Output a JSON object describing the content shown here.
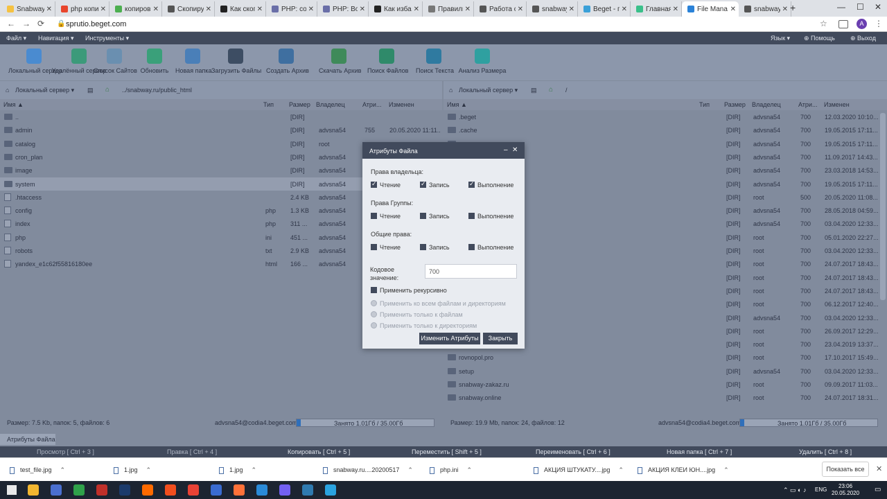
{
  "browser": {
    "tabs": [
      {
        "title": "Snabway",
        "color": "#f5c242"
      },
      {
        "title": "php копи",
        "color": "#e8452c"
      },
      {
        "title": "копиров",
        "color": "#4caf50"
      },
      {
        "title": "Скопиру",
        "color": "#555555"
      },
      {
        "title": "Как скоп",
        "color": "#222222"
      },
      {
        "title": "PHP: cop",
        "color": "#6a6fa8"
      },
      {
        "title": "PHP: Воз",
        "color": "#6a6fa8"
      },
      {
        "title": "Как изба",
        "color": "#222222"
      },
      {
        "title": "Правиль",
        "color": "#777777"
      },
      {
        "title": "Работа с",
        "color": "#555555"
      },
      {
        "title": "snabway",
        "color": "#555555"
      },
      {
        "title": "Beget - п",
        "color": "#3aa0d8"
      },
      {
        "title": "Главная",
        "color": "#3ac08a"
      },
      {
        "title": "File Mana",
        "color": "#2a82d8"
      },
      {
        "title": "snabway",
        "color": "#555555"
      }
    ],
    "url": "sprutio.beget.com",
    "avatar": "A"
  },
  "menubar": {
    "items": [
      "Файл ▾",
      "Навигация ▾",
      "Инструменты ▾"
    ],
    "right": [
      "Язык ▾",
      "Помощь",
      "Выход"
    ]
  },
  "toolbar": {
    "buttons": [
      {
        "label": "Локальный сервер",
        "color": "#4a8bd0"
      },
      {
        "label": "Удалённый сервер",
        "color": "#3c9a7a"
      },
      {
        "label": "Список Сайтов",
        "color": "#6a8fb0"
      },
      {
        "label": "Обновить",
        "color": "#3aa07a"
      },
      {
        "label": "Новая папка",
        "color": "#4a7fb8"
      },
      {
        "label": "Загрузить Файлы",
        "color": "#3d4d63"
      },
      {
        "label": "Создать Архив",
        "color": "#3f6fa0"
      },
      {
        "label": "Скачать Архив",
        "color": "#3f8a5a"
      },
      {
        "label": "Поиск Файлов",
        "color": "#2f8a6a"
      },
      {
        "label": "Поиск Текста",
        "color": "#2f7aa0"
      },
      {
        "label": "Анализ Размера",
        "color": "#2fa0a0"
      }
    ]
  },
  "left_panel": {
    "server": "Локальный сервер",
    "path": "../snabway.ru/public_html",
    "columns": [
      "Имя ▲",
      "Тип",
      "Размер",
      "Владелец",
      "Атри...",
      "Изменен"
    ],
    "rows": [
      {
        "name": "..",
        "type": "",
        "size": "[DIR]",
        "owner": "",
        "attr": "",
        "mod": "",
        "dir": true
      },
      {
        "name": "admin",
        "type": "",
        "size": "[DIR]",
        "owner": "advsna54",
        "attr": "755",
        "mod": "20.05.2020 11:11...",
        "dir": true
      },
      {
        "name": "catalog",
        "type": "",
        "size": "[DIR]",
        "owner": "root",
        "attr": "",
        "mod": "",
        "dir": true
      },
      {
        "name": "cron_plan",
        "type": "",
        "size": "[DIR]",
        "owner": "advsna54",
        "attr": "",
        "mod": "",
        "dir": true
      },
      {
        "name": "image",
        "type": "",
        "size": "[DIR]",
        "owner": "advsna54",
        "attr": "",
        "mod": "",
        "dir": true
      },
      {
        "name": "system",
        "type": "",
        "size": "[DIR]",
        "owner": "advsna54",
        "attr": "",
        "mod": "",
        "dir": true,
        "selected": true
      },
      {
        "name": ".htaccess",
        "type": "",
        "size": "2.4 KB",
        "owner": "advsna54",
        "attr": "",
        "mod": "",
        "dir": false
      },
      {
        "name": "config",
        "type": "php",
        "size": "1.3 KB",
        "owner": "advsna54",
        "attr": "",
        "mod": "",
        "dir": false
      },
      {
        "name": "index",
        "type": "php",
        "size": "311 ...",
        "owner": "advsna54",
        "attr": "",
        "mod": "",
        "dir": false
      },
      {
        "name": "php",
        "type": "ini",
        "size": "451 ...",
        "owner": "advsna54",
        "attr": "",
        "mod": "",
        "dir": false
      },
      {
        "name": "robots",
        "type": "txt",
        "size": "2.9 KB",
        "owner": "advsna54",
        "attr": "",
        "mod": "",
        "dir": false
      },
      {
        "name": "yandex_e1c62f55816180ee",
        "type": "html",
        "size": "166 ...",
        "owner": "advsna54",
        "attr": "",
        "mod": "",
        "dir": false
      }
    ],
    "status": "Размер: 7.5 Kb, папок: 5, файлов: 6",
    "user": "advsna54@codia4.beget.com",
    "usage": "Занято 1.01Гб / 35.00Гб",
    "usage_fraction": 0.03
  },
  "right_panel": {
    "server": "Локальный сервер",
    "path": "/",
    "columns": [
      "Имя ▲",
      "Тип",
      "Размер",
      "Владелец",
      "Атри...",
      "Изменен"
    ],
    "rows": [
      {
        "name": ".beget",
        "size": "[DIR]",
        "owner": "advsna54",
        "attr": "700",
        "mod": "12.03.2020 10:10..."
      },
      {
        "name": ".cache",
        "size": "[DIR]",
        "owner": "advsna54",
        "attr": "700",
        "mod": "19.05.2015 17:11..."
      },
      {
        "name": "",
        "size": "[DIR]",
        "owner": "advsna54",
        "attr": "700",
        "mod": "19.05.2015 17:11..."
      },
      {
        "name": "",
        "size": "[DIR]",
        "owner": "advsna54",
        "attr": "700",
        "mod": "11.09.2017 14:43..."
      },
      {
        "name": "",
        "size": "[DIR]",
        "owner": "advsna54",
        "attr": "700",
        "mod": "23.03.2018 14:53..."
      },
      {
        "name": "",
        "size": "[DIR]",
        "owner": "advsna54",
        "attr": "700",
        "mod": "19.05.2015 17:11..."
      },
      {
        "name": "",
        "size": "[DIR]",
        "owner": "root",
        "attr": "500",
        "mod": "20.05.2020 11:08..."
      },
      {
        "name": "",
        "size": "[DIR]",
        "owner": "advsna54",
        "attr": "700",
        "mod": "28.05.2018 04:59..."
      },
      {
        "name": "",
        "size": "[DIR]",
        "owner": "advsna54",
        "attr": "700",
        "mod": "03.04.2020 12:33..."
      },
      {
        "name": "",
        "size": "[DIR]",
        "owner": "root",
        "attr": "700",
        "mod": "05.01.2020 22:27..."
      },
      {
        "name": "",
        "size": "[DIR]",
        "owner": "root",
        "attr": "700",
        "mod": "03.04.2020 12:33..."
      },
      {
        "name": "",
        "size": "[DIR]",
        "owner": "root",
        "attr": "700",
        "mod": "24.07.2017 18:43..."
      },
      {
        "name": "",
        "size": "[DIR]",
        "owner": "root",
        "attr": "700",
        "mod": "24.07.2017 18:43..."
      },
      {
        "name": "",
        "size": "[DIR]",
        "owner": "root",
        "attr": "700",
        "mod": "24.07.2017 18:43..."
      },
      {
        "name": "",
        "size": "[DIR]",
        "owner": "root",
        "attr": "700",
        "mod": "06.12.2017 12:40..."
      },
      {
        "name": "",
        "size": "[DIR]",
        "owner": "advsna54",
        "attr": "700",
        "mod": "03.04.2020 12:33..."
      },
      {
        "name": "",
        "size": "[DIR]",
        "owner": "root",
        "attr": "700",
        "mod": "26.09.2017 12:29..."
      },
      {
        "name": "",
        "size": "[DIR]",
        "owner": "root",
        "attr": "700",
        "mod": "23.04.2019 13:37..."
      },
      {
        "name": "rovnopol.pro",
        "size": "[DIR]",
        "owner": "root",
        "attr": "700",
        "mod": "17.10.2017 15:49..."
      },
      {
        "name": "setup",
        "size": "[DIR]",
        "owner": "advsna54",
        "attr": "700",
        "mod": "03.04.2020 12:33..."
      },
      {
        "name": "snabway-zakaz.ru",
        "size": "[DIR]",
        "owner": "root",
        "attr": "700",
        "mod": "09.09.2017 11:03..."
      },
      {
        "name": "snabway.online",
        "size": "[DIR]",
        "owner": "root",
        "attr": "700",
        "mod": "24.07.2017 18:31..."
      }
    ],
    "status": "Размер: 19.9 Mb, папок: 24, файлов: 12",
    "user": "advsna54@codia4.beget.com",
    "usage": "Занято 1.01Гб / 35.00Гб",
    "usage_fraction": 0.03
  },
  "bottom_tab": "Атрибуты Файла",
  "hotkeys": [
    "Просмотр [ Ctrl + 3 ]",
    "Правка [ Ctrl + 4 ]",
    "Копировать [ Ctrl + 5 ]",
    "Переместить [ Shift + 5 ]",
    "Переименовать [ Ctrl + 6 ]",
    "Новая папка [ Ctrl + 7 ]",
    "Удалить [ Ctrl + 8 ]"
  ],
  "dialog": {
    "title": "Атрибуты Файла",
    "owner_title": "Права владельца:",
    "group_title": "Права Группы:",
    "other_title": "Общие права:",
    "read": "Чтение",
    "write": "Запись",
    "exec": "Выполнение",
    "owner": [
      true,
      true,
      true
    ],
    "group": [
      false,
      false,
      false
    ],
    "other": [
      false,
      false,
      false
    ],
    "code_label": "Кодовое значение:",
    "code_value": "700",
    "recursive": "Применить рекурсивно",
    "radio": [
      "Применить ко всем файлам и директориям",
      "Применить только к файлам",
      "Применить только к директориям"
    ],
    "apply": "Изменить Атрибуты",
    "close": "Закрыть"
  },
  "downloads": {
    "items": [
      "test_file.jpg",
      "1.jpg",
      "1.jpg",
      "snabway.ru....20200517",
      "php.ini",
      "АКЦИЯ ШТУКАТУ....jpg",
      "АКЦИЯ КЛЕИ ЮН....jpg"
    ],
    "show_all": "Показать все"
  },
  "taskbar": {
    "icons": [
      {
        "name": "explorer",
        "color": "#f2b630"
      },
      {
        "name": "save",
        "color": "#4a6fd0"
      },
      {
        "name": "s-app",
        "color": "#2fa14a"
      },
      {
        "name": "filezilla",
        "color": "#c0302a"
      },
      {
        "name": "photoshop",
        "color": "#1b3a6b"
      },
      {
        "name": "app",
        "color": "#ff6a00"
      },
      {
        "name": "figma",
        "color": "#f24e1e"
      },
      {
        "name": "chrome",
        "color": "#e94235"
      },
      {
        "name": "tool",
        "color": "#3a6bd0"
      },
      {
        "name": "firefox",
        "color": "#ff7139"
      },
      {
        "name": "vscode",
        "color": "#2a8ad8"
      },
      {
        "name": "viber",
        "color": "#7360f2"
      },
      {
        "name": "app2",
        "color": "#2f7ab0"
      },
      {
        "name": "telegram",
        "color": "#2aa3e0"
      }
    ],
    "lang": "ENG",
    "time": "23:06",
    "date": "20.05.2020"
  }
}
